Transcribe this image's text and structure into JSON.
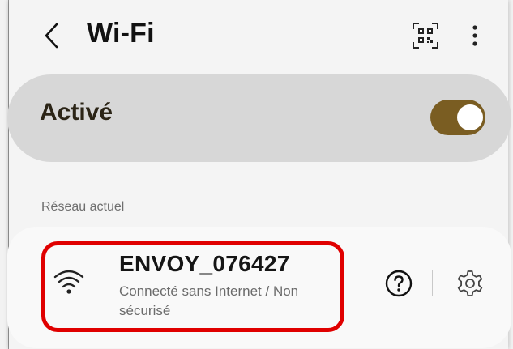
{
  "header": {
    "title": "Wi-Fi",
    "back_icon": "chevron-left-icon",
    "qr_icon": "qr-scan-icon",
    "more_icon": "more-vertical-icon"
  },
  "wifi_toggle": {
    "label": "Activé",
    "state": "on",
    "accent_color": "#7a5d22"
  },
  "current_network": {
    "section_label": "Réseau actuel",
    "ssid": "ENVOY_076427",
    "status": "Connecté sans Internet / Non sécurisé",
    "signal_icon": "wifi-signal-icon",
    "help_icon": "question-circle-icon",
    "settings_icon": "gear-icon",
    "highlight_color": "#e00000"
  }
}
